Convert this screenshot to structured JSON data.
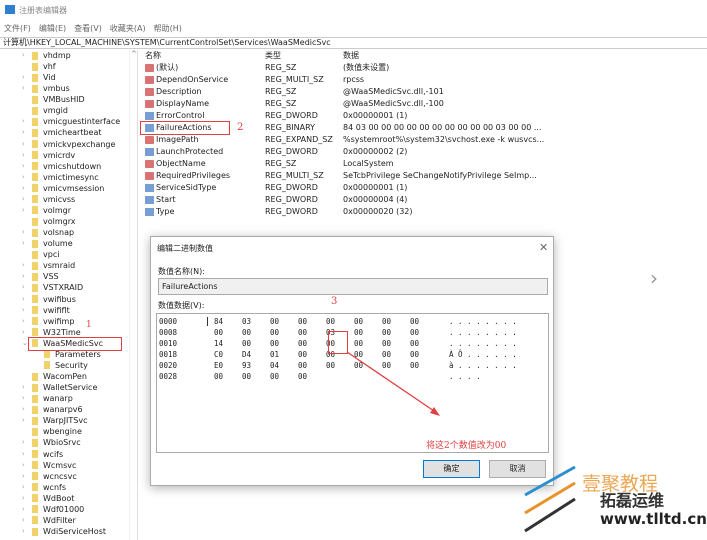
{
  "window": {
    "title": "注册表编辑器",
    "menu": [
      "文件(F)",
      "编辑(E)",
      "查看(V)",
      "收藏夹(A)",
      "帮助(H)"
    ],
    "address": "计算机\\HKEY_LOCAL_MACHINE\\SYSTEM\\CurrentControlSet\\Services\\WaaSMedicSvc"
  },
  "tree": {
    "items": [
      {
        "label": "vhdmp",
        "exp": ">"
      },
      {
        "label": "vhf",
        "exp": ""
      },
      {
        "label": "Vid",
        "exp": ">"
      },
      {
        "label": "vmbus",
        "exp": ">"
      },
      {
        "label": "VMBusHID",
        "exp": ""
      },
      {
        "label": "vmgid",
        "exp": ""
      },
      {
        "label": "vmicguestinterface",
        "exp": ">"
      },
      {
        "label": "vmicheartbeat",
        "exp": ">"
      },
      {
        "label": "vmickvpexchange",
        "exp": ">"
      },
      {
        "label": "vmicrdv",
        "exp": ">"
      },
      {
        "label": "vmicshutdown",
        "exp": ">"
      },
      {
        "label": "vmictimesync",
        "exp": ">"
      },
      {
        "label": "vmicvmsession",
        "exp": ">"
      },
      {
        "label": "vmicvss",
        "exp": ">"
      },
      {
        "label": "volmgr",
        "exp": ">"
      },
      {
        "label": "volmgrx",
        "exp": ""
      },
      {
        "label": "volsnap",
        "exp": ">"
      },
      {
        "label": "volume",
        "exp": ">"
      },
      {
        "label": "vpci",
        "exp": ""
      },
      {
        "label": "vsmraid",
        "exp": ">"
      },
      {
        "label": "VSS",
        "exp": ">"
      },
      {
        "label": "VSTXRAID",
        "exp": ">"
      },
      {
        "label": "vwifibus",
        "exp": ">"
      },
      {
        "label": "vwififlt",
        "exp": ">"
      },
      {
        "label": "vwifimp",
        "exp": ">"
      },
      {
        "label": "W32Time",
        "exp": ">"
      },
      {
        "label": "WaaSMedicSvc",
        "exp": "v"
      },
      {
        "label": "Parameters",
        "exp": "",
        "child": true
      },
      {
        "label": "Security",
        "exp": "",
        "child": true
      },
      {
        "label": "WacomPen",
        "exp": ""
      },
      {
        "label": "WalletService",
        "exp": ">"
      },
      {
        "label": "wanarp",
        "exp": ">"
      },
      {
        "label": "wanarpv6",
        "exp": ">"
      },
      {
        "label": "WarpJITSvc",
        "exp": ">"
      },
      {
        "label": "wbengine",
        "exp": ""
      },
      {
        "label": "WbioSrvc",
        "exp": ">"
      },
      {
        "label": "wcifs",
        "exp": ">"
      },
      {
        "label": "Wcmsvc",
        "exp": ">"
      },
      {
        "label": "wcncsvc",
        "exp": ">"
      },
      {
        "label": "wcnfs",
        "exp": ">"
      },
      {
        "label": "WdBoot",
        "exp": ">"
      },
      {
        "label": "Wdf01000",
        "exp": ">"
      },
      {
        "label": "WdFilter",
        "exp": ">"
      },
      {
        "label": "WdiServiceHost",
        "exp": ">"
      }
    ]
  },
  "list": {
    "headers": [
      "名称",
      "类型",
      "数据"
    ],
    "rows": [
      {
        "name": "(默认)",
        "type": "REG_SZ",
        "data": "(数值未设置)",
        "icon": "sz"
      },
      {
        "name": "DependOnService",
        "type": "REG_MULTI_SZ",
        "data": "rpcss",
        "icon": "sz"
      },
      {
        "name": "Description",
        "type": "REG_SZ",
        "data": "@WaaSMedicSvc.dll,-101",
        "icon": "sz"
      },
      {
        "name": "DisplayName",
        "type": "REG_SZ",
        "data": "@WaaSMedicSvc.dll,-100",
        "icon": "sz"
      },
      {
        "name": "ErrorControl",
        "type": "REG_DWORD",
        "data": "0x00000001 (1)",
        "icon": "bin"
      },
      {
        "name": "FailureActions",
        "type": "REG_BINARY",
        "data": "84 03 00 00 00 00 00 00 00 00 00 00 03 00 00 ...",
        "icon": "bin"
      },
      {
        "name": "ImagePath",
        "type": "REG_EXPAND_SZ",
        "data": "%systemroot%\\system32\\svchost.exe -k wusvcs...",
        "icon": "sz"
      },
      {
        "name": "LaunchProtected",
        "type": "REG_DWORD",
        "data": "0x00000002 (2)",
        "icon": "bin"
      },
      {
        "name": "ObjectName",
        "type": "REG_SZ",
        "data": "LocalSystem",
        "icon": "sz"
      },
      {
        "name": "RequiredPrivileges",
        "type": "REG_MULTI_SZ",
        "data": "SeTcbPrivilege SeChangeNotifyPrivilege SeImp...",
        "icon": "sz"
      },
      {
        "name": "ServiceSidType",
        "type": "REG_DWORD",
        "data": "0x00000001 (1)",
        "icon": "bin"
      },
      {
        "name": "Start",
        "type": "REG_DWORD",
        "data": "0x00000004 (4)",
        "icon": "bin"
      },
      {
        "name": "Type",
        "type": "REG_DWORD",
        "data": "0x00000020 (32)",
        "icon": "bin"
      }
    ]
  },
  "dialog": {
    "title": "编辑二进制数值",
    "name_label": "数值名称(N):",
    "name_value": "FailureActions",
    "data_label": "数值数据(V):",
    "ok": "确定",
    "cancel": "取消",
    "hex": [
      {
        "off": "0000",
        "bytes": [
          "84",
          "03",
          "00",
          "00",
          "00",
          "00",
          "00",
          "00"
        ],
        "ascii": ". . . . . . . ."
      },
      {
        "off": "0008",
        "bytes": [
          "00",
          "00",
          "00",
          "00",
          "03",
          "00",
          "00",
          "00"
        ],
        "ascii": ". . . . . . . ."
      },
      {
        "off": "0010",
        "bytes": [
          "14",
          "00",
          "00",
          "00",
          "00",
          "00",
          "00",
          "00"
        ],
        "ascii": ". . . . . . . ."
      },
      {
        "off": "0018",
        "bytes": [
          "C0",
          "D4",
          "01",
          "00",
          "00",
          "00",
          "00",
          "00"
        ],
        "ascii": "À Ô . . . . . ."
      },
      {
        "off": "0020",
        "bytes": [
          "E0",
          "93",
          "04",
          "00",
          "00",
          "00",
          "00",
          "00"
        ],
        "ascii": "à . . . . . . ."
      },
      {
        "off": "0028",
        "bytes": [
          "00",
          "00",
          "00",
          "00"
        ],
        "ascii": ". . . ."
      }
    ]
  },
  "annotations": {
    "n1": "1",
    "n2": "2",
    "n3": "3",
    "note": "将这2个数值改为00",
    "color": "#e04040"
  },
  "watermark": {
    "line1": "壹聚教程",
    "line2": "拓磊运维",
    "url": "www.tlltd.cn"
  }
}
